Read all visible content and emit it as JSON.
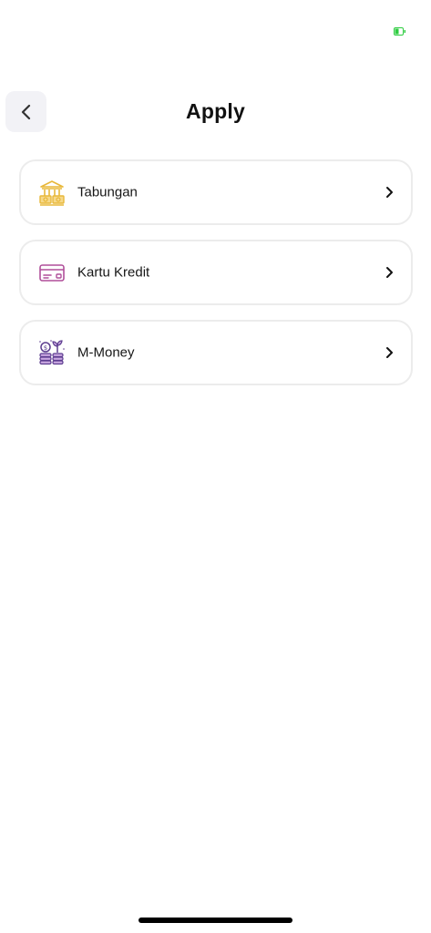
{
  "status_bar": {
    "battery_icon": "battery-charging-icon",
    "battery_color": "#2ecc40"
  },
  "header": {
    "back_icon": "chevron-left-icon",
    "title": "Apply"
  },
  "menu": {
    "items": [
      {
        "label": "Tabungan",
        "icon": "bank-savings-icon",
        "icon_color": "#e8b83a"
      },
      {
        "label": "Kartu Kredit",
        "icon": "credit-card-icon",
        "icon_color": "#b04f9a"
      },
      {
        "label": "M-Money",
        "icon": "money-growth-icon",
        "icon_color": "#5c3d8f"
      }
    ],
    "chevron_icon": "chevron-right-icon"
  },
  "colors": {
    "background": "#ffffff",
    "card_border": "#ececec",
    "back_button_bg": "#f2f2f6",
    "text": "#111111"
  }
}
